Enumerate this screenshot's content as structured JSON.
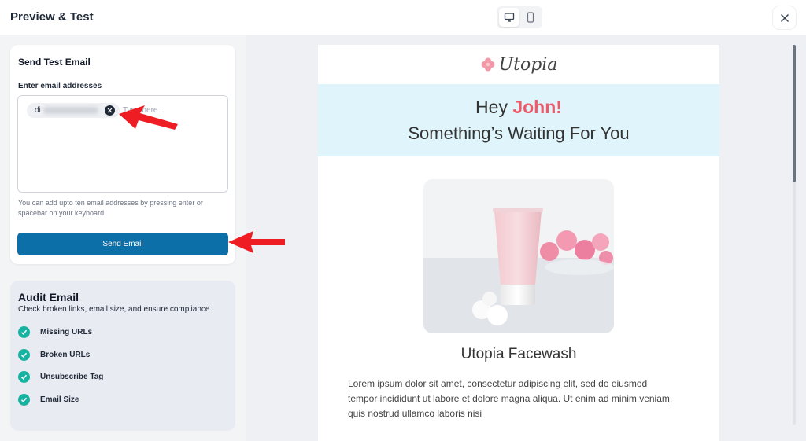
{
  "header": {
    "title": "Preview & Test",
    "device_toggle": {
      "desktop_icon": "monitor-icon",
      "mobile_icon": "smartphone-icon",
      "selected": "desktop"
    },
    "close_icon": "close-icon"
  },
  "send_test": {
    "title": "Send Test Email",
    "field_label": "Enter email addresses",
    "chips": [
      {
        "text": "di"
      }
    ],
    "input_placeholder": "Type here...",
    "help_text": "You can add upto ten email addresses by pressing enter or spacebar on your keyboard",
    "button_label": "Send Email",
    "button_color": "#0d6fa8"
  },
  "audit": {
    "title": "Audit Email",
    "subtitle": "Check broken links, email size, and ensure compliance",
    "items": [
      {
        "label": "Missing URLs",
        "status": "passed"
      },
      {
        "label": "Broken URLs",
        "status": "passed"
      },
      {
        "label": "Unsubscribe Tag",
        "status": "passed"
      },
      {
        "label": "Email Size",
        "status": "passed"
      }
    ],
    "check_color": "#17b3a0"
  },
  "preview": {
    "logo_text": "Utopia",
    "greeting_prefix": "Hey ",
    "greeting_name": "John!",
    "headline": "Something’s Waiting For You",
    "product_name": "Utopia Facewash",
    "body": "Lorem ipsum dolor sit amet, consectetur adipiscing elit, sed do eiusmod tempor incididunt ut labore et dolore magna aliqua. Ut enim ad minim veniam, quis nostrud ullamco laboris nisi",
    "accent_color": "#ee5a6a",
    "banner_color": "#dff4fb"
  }
}
